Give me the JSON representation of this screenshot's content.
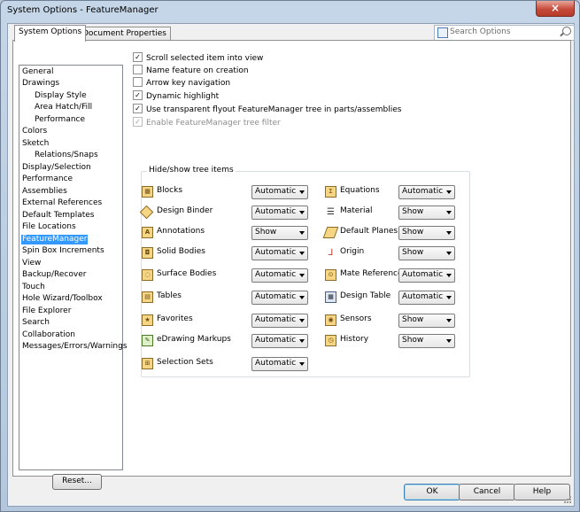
{
  "window": {
    "title": "System Options - FeatureManager",
    "close_label": "×"
  },
  "tabs": [
    {
      "label": "System Options"
    },
    {
      "label": "Document Properties"
    }
  ],
  "search": {
    "placeholder": "Search Options"
  },
  "tree": {
    "items": [
      {
        "label": "General"
      },
      {
        "label": "Drawings"
      },
      {
        "label": "Display Style"
      },
      {
        "label": "Area Hatch/Fill"
      },
      {
        "label": "Performance"
      },
      {
        "label": "Colors"
      },
      {
        "label": "Sketch"
      },
      {
        "label": "Relations/Snaps"
      },
      {
        "label": "Display/Selection"
      },
      {
        "label": "Performance"
      },
      {
        "label": "Assemblies"
      },
      {
        "label": "External References"
      },
      {
        "label": "Default Templates"
      },
      {
        "label": "File Locations"
      },
      {
        "label": "FeatureManager"
      },
      {
        "label": "Spin Box Increments"
      },
      {
        "label": "View"
      },
      {
        "label": "Backup/Recover"
      },
      {
        "label": "Touch"
      },
      {
        "label": "Hole Wizard/Toolbox"
      },
      {
        "label": "File Explorer"
      },
      {
        "label": "Search"
      },
      {
        "label": "Collaboration"
      },
      {
        "label": "Messages/Errors/Warnings"
      }
    ],
    "selected": "FeatureManager"
  },
  "reset_label": "Reset...",
  "options": [
    {
      "label": "Scroll selected item into view",
      "checked": true
    },
    {
      "label": "Name feature on creation",
      "checked": false
    },
    {
      "label": "Arrow key navigation",
      "checked": false
    },
    {
      "label": "Dynamic highlight",
      "checked": true
    },
    {
      "label": "Use transparent flyout FeatureManager tree in parts/assemblies",
      "checked": true
    },
    {
      "label": "Enable FeatureManager tree filter",
      "checked": true,
      "disabled": true
    }
  ],
  "tree_items_group": {
    "title": "Hide/show tree items",
    "left": [
      {
        "label": "Blocks",
        "value": "Automatic",
        "icon": "blocks-icon"
      },
      {
        "label": "Design Binder",
        "value": "Automatic",
        "icon": "design-binder-icon"
      },
      {
        "label": "Annotations",
        "value": "Show",
        "icon": "annotations-icon"
      },
      {
        "label": "Solid Bodies",
        "value": "Automatic",
        "icon": "solid-bodies-icon"
      },
      {
        "label": "Surface Bodies",
        "value": "Automatic",
        "icon": "surface-bodies-icon"
      },
      {
        "label": "Tables",
        "value": "Automatic",
        "icon": "tables-icon"
      },
      {
        "label": "Favorites",
        "value": "Automatic",
        "icon": "favorites-icon"
      },
      {
        "label": "eDrawing Markups",
        "value": "Automatic",
        "icon": "edrawing-markups-icon"
      },
      {
        "label": "Selection Sets",
        "value": "Automatic",
        "icon": "selection-sets-icon"
      }
    ],
    "right": [
      {
        "label": "Equations",
        "value": "Automatic",
        "icon": "equations-icon"
      },
      {
        "label": "Material",
        "value": "Show",
        "icon": "material-icon"
      },
      {
        "label": "Default Planes",
        "value": "Show",
        "icon": "default-planes-icon"
      },
      {
        "label": "Origin",
        "value": "Show",
        "icon": "origin-icon"
      },
      {
        "label": "Mate References",
        "value": "Automatic",
        "icon": "mate-references-icon"
      },
      {
        "label": "Design Table",
        "value": "Automatic",
        "icon": "design-table-icon"
      },
      {
        "label": "Sensors",
        "value": "Show",
        "icon": "sensors-icon"
      },
      {
        "label": "History",
        "value": "Show",
        "icon": "history-icon"
      }
    ]
  },
  "buttons": {
    "ok": "OK",
    "cancel": "Cancel",
    "help": "Help"
  }
}
